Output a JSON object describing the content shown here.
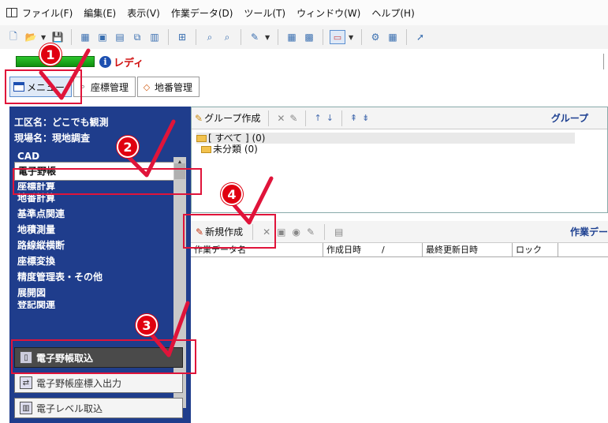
{
  "menu": [
    "ファイル(F)",
    "編集(E)",
    "表示(V)",
    "作業データ(D)",
    "ツール(T)",
    "ウィンドウ(W)",
    "ヘルプ(H)"
  ],
  "status": {
    "text": "レディ",
    "icon": "i"
  },
  "tabs": [
    {
      "label": "メニュー"
    },
    {
      "label": "座標管理"
    },
    {
      "label": "地番管理"
    }
  ],
  "info": {
    "district": "工区名：どこでも観測",
    "site": "現場名：現地調査"
  },
  "nav": {
    "clipped_top": "CAD",
    "items": [
      "電子野帳",
      "座標計算",
      "地番計算",
      "基準点関連",
      "地積測量",
      "路線縦横断",
      "座標変換",
      "精度管理表・その他",
      "展開図"
    ],
    "clipped_bottom": "登記関連"
  },
  "buttons": [
    "電子野帳取込",
    "電子野帳座標入出力",
    "電子レベル取込"
  ],
  "group_pane": {
    "create_label": "グループ作成",
    "title": "グループ",
    "tree": [
      "[ すべて ] (0)",
      "未分類 (0)"
    ]
  },
  "work_pane": {
    "new_label": "新規作成",
    "title": "作業デー",
    "columns": [
      "作業データ名",
      "作成日時",
      "/",
      "最終更新日時",
      "ロック"
    ]
  },
  "callouts": [
    "1",
    "2",
    "3",
    "4"
  ],
  "colors": {
    "panel": "#1f3d8c",
    "accent": "#e00010",
    "status_green": "#2cc52c"
  }
}
